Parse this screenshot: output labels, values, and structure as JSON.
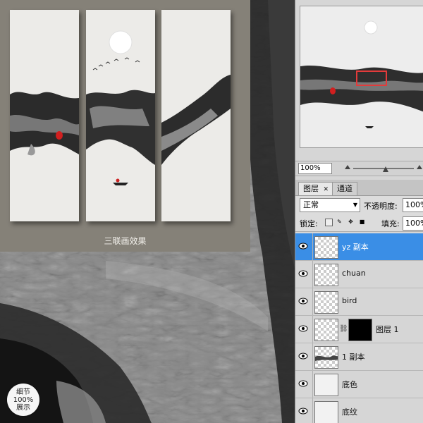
{
  "preview": {
    "caption": "三联画效果"
  },
  "badge": {
    "line1": "细节",
    "line2": "100%",
    "line3": "展示"
  },
  "navigator": {
    "zoom_value": "100%"
  },
  "layers_panel": {
    "tabs": [
      "图层",
      "通道"
    ],
    "blend_mode": "正常",
    "opacity_label": "不透明度:",
    "opacity_value": "100%",
    "lock_label": "锁定:",
    "fill_label": "填充:",
    "fill_value": "100%",
    "layers": [
      {
        "name": "yz 副本",
        "selected": true
      },
      {
        "name": "chuan",
        "selected": false
      },
      {
        "name": "bird",
        "selected": false
      },
      {
        "name": "图层 1",
        "selected": false
      },
      {
        "name": "1 副本",
        "selected": false
      },
      {
        "name": "底色",
        "selected": false
      },
      {
        "name": "底纹",
        "selected": false
      }
    ]
  },
  "colors": {
    "selection_blue": "#3a8ee6",
    "seal_red": "#d11f1f",
    "preview_frame": "#858178"
  }
}
